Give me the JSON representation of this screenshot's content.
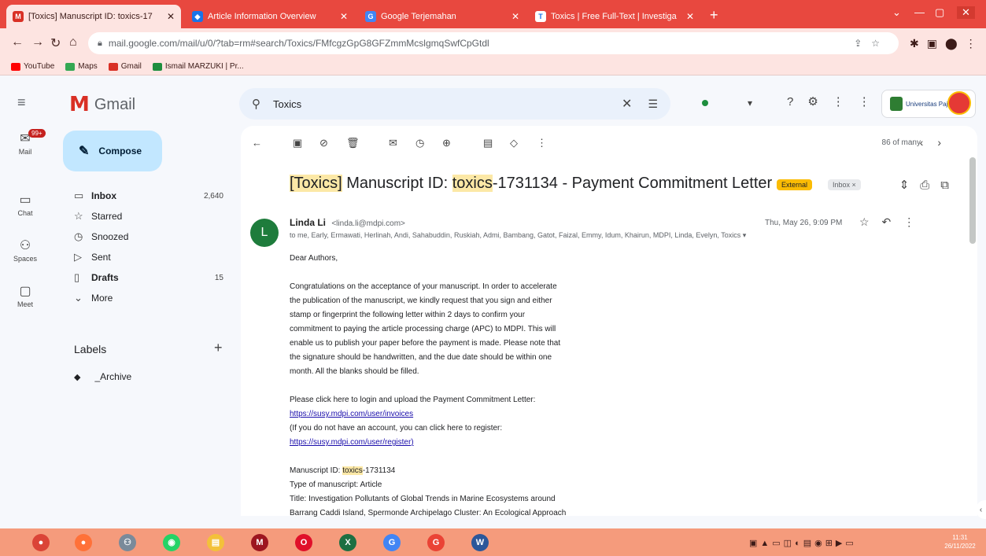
{
  "browser": {
    "tabs": [
      {
        "title": "[Toxics] Manuscript ID: toxics-17",
        "active": true,
        "favicon_color": "#d93025",
        "favicon_glyph": "M"
      },
      {
        "title": "Article Information Overview",
        "active": false,
        "favicon_color": "#1a73e8",
        "favicon_glyph": "◆"
      },
      {
        "title": "Google Terjemahan",
        "active": false,
        "favicon_color": "#4285f4",
        "favicon_glyph": "G"
      },
      {
        "title": "Toxics | Free Full-Text | Investiga",
        "active": false,
        "favicon_color": "#ffffff",
        "favicon_glyph": "T"
      }
    ],
    "url": "mail.google.com/mail/u/0/?tab=rm#search/Toxics/FMfcgzGpG8GFZmmMcslgmqSwfCpGtdl",
    "bookmarks": [
      {
        "label": "YouTube",
        "color": "#ff0000"
      },
      {
        "label": "Maps",
        "color": "#34a853"
      },
      {
        "label": "Gmail",
        "color": "#d93025"
      },
      {
        "label": "Ismail MARZUKI | Pr...",
        "color": "#1e8e3e"
      }
    ]
  },
  "gmail": {
    "app_name": "Gmail",
    "search_query": "Toxics",
    "compose_label": "Compose",
    "rail": [
      {
        "label": "Mail",
        "icon": "mail-icon",
        "glyph": "✉",
        "badge": "99+"
      },
      {
        "label": "Chat",
        "icon": "chat-icon",
        "glyph": "▭"
      },
      {
        "label": "Spaces",
        "icon": "spaces-icon",
        "glyph": "⚇"
      },
      {
        "label": "Meet",
        "icon": "meet-icon",
        "glyph": "▢"
      }
    ],
    "nav": [
      {
        "label": "Inbox",
        "count": "2,640",
        "icon": "inbox-icon",
        "glyph": "▭",
        "bold": true
      },
      {
        "label": "Starred",
        "count": "",
        "icon": "star-icon",
        "glyph": "☆",
        "bold": false
      },
      {
        "label": "Snoozed",
        "count": "",
        "icon": "clock-icon",
        "glyph": "◷",
        "bold": false
      },
      {
        "label": "Sent",
        "count": "",
        "icon": "send-icon",
        "glyph": "▷",
        "bold": false
      },
      {
        "label": "Drafts",
        "count": "15",
        "icon": "draft-icon",
        "glyph": "▯",
        "bold": true
      },
      {
        "label": "More",
        "count": "",
        "icon": "chevron-down-icon",
        "glyph": "⌄",
        "bold": false
      }
    ],
    "labels_heading": "Labels",
    "labels": [
      {
        "name": "_Archive"
      }
    ],
    "pager": "86 of many",
    "org_name": "Universitas Pajar"
  },
  "message": {
    "subject_parts": [
      {
        "text": "[Toxics]",
        "hl": true
      },
      {
        "text": " Manuscript ID: ",
        "hl": false
      },
      {
        "text": "toxics",
        "hl": true
      },
      {
        "text": "-1731134 - Payment Commitment Letter",
        "hl": false
      }
    ],
    "chip_external": "External",
    "chip_inbox": "Inbox ×",
    "sender_initial": "L",
    "sender_name": "Linda Li",
    "sender_email": "<linda.li@mdpi.com>",
    "recipients": "to me, Early, Ermawati, Herlinah, Andi, Sahabuddin, Ruskiah, Admi, Bambang, Gatot, Faizal, Emmy, Idum, Khairun, MDPI, Linda, Evelyn, Toxics ▾",
    "date": "Thu, May 26, 9:09 PM",
    "greeting": "Dear Authors,",
    "para1": [
      "Congratulations on the acceptance of your manuscript. In order to accelerate",
      "the publication of the manuscript, we kindly request that you sign and either",
      "stamp or fingerprint the following letter within 2 days to confirm your",
      "commitment to paying the article processing charge (APC) to MDPI. This will",
      "enable us to publish your paper before the payment is made. Please note that",
      "the signature should be handwritten, and the due date should be within one",
      "month. All the blanks should be filled."
    ],
    "para2_line1": "Please click here to login and upload the Payment Commitment Letter:",
    "link_invoices": "https://susy.mdpi.com/user/invoices",
    "para2_line3": "(If you do not have an account, you can click here to register:",
    "link_register": "https://susy.mdpi.com/user/register)",
    "ms_id_prefix": "Manuscript ID: ",
    "ms_id_hl": "toxics",
    "ms_id_suffix": "-1731134",
    "ms_type": "Type of manuscript: Article",
    "ms_title_1": "Title: Investigation Pollutants of Global Trends in Marine Ecosystems around",
    "ms_title_2": "Barrang Caddi Island, Spermonde Archipelago Cluster: An Ecological Approach"
  },
  "taskbar": {
    "apps": [
      {
        "name": "chrome",
        "color": "#db4437",
        "glyph": "●"
      },
      {
        "name": "firefox",
        "color": "#ff7139",
        "glyph": "●"
      },
      {
        "name": "people",
        "color": "#7a8a9a",
        "glyph": "⚇"
      },
      {
        "name": "whatsapp",
        "color": "#25d366",
        "glyph": "◉"
      },
      {
        "name": "explorer",
        "color": "#f3c13a",
        "glyph": "▤"
      },
      {
        "name": "mendeley",
        "color": "#9d1620",
        "glyph": "M"
      },
      {
        "name": "opera",
        "color": "#e0102a",
        "glyph": "O"
      },
      {
        "name": "excel",
        "color": "#1d6f42",
        "glyph": "X"
      },
      {
        "name": "chrome-profile-2",
        "color": "#4285f4",
        "glyph": "G"
      },
      {
        "name": "chrome-profile-3",
        "color": "#ea4335",
        "glyph": "G"
      },
      {
        "name": "word",
        "color": "#2b579a",
        "glyph": "W"
      }
    ],
    "time": "11:31",
    "date": "26/11/2022"
  }
}
